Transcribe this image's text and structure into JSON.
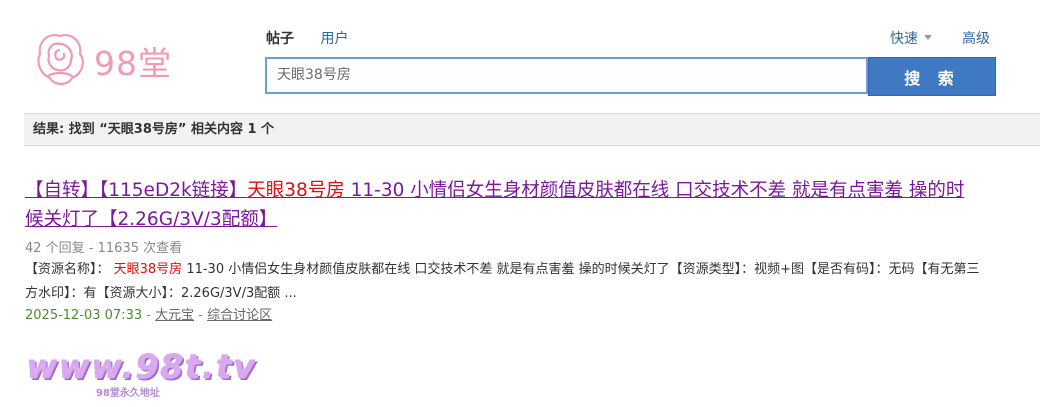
{
  "logo": {
    "text": "98堂"
  },
  "tabs": {
    "active": "帖子",
    "other": "用户"
  },
  "header": {
    "quick": "快速",
    "advanced": "高级"
  },
  "search": {
    "value": "天眼38号房",
    "button": "搜 索"
  },
  "result_summary": "结果: 找到 “天眼38号房” 相关内容 1 个",
  "result": {
    "title_pre": "【自转】【115eD2k链接】",
    "title_hl": "天眼38号房",
    "title_post": " 11-30 小情侣女生身材颜值皮肤都在线 口交技术不差 就是有点害羞 操的时候关灯了【2.26G/3V/3配额】",
    "meta": "42 个回复 - 11635 次查看",
    "desc_pre": "【资源名称】： ",
    "desc_hl": "天眼38号房",
    "desc_post": " 11-30 小情侣女生身材颜值皮肤都在线 口交技术不差 就是有点害羞 操的时候关灯了【资源类型】：视频+图【是否有码】：无码【有无第三方水印】：有【资源大小】：2.26G/3V/3配额 ...",
    "date": "2025-12-03 07:33",
    "sep": " - ",
    "author": "大元宝",
    "forum": "综合讨论区"
  },
  "watermark": {
    "text": "www.98t.tv",
    "subtext": "98堂永久地址"
  }
}
